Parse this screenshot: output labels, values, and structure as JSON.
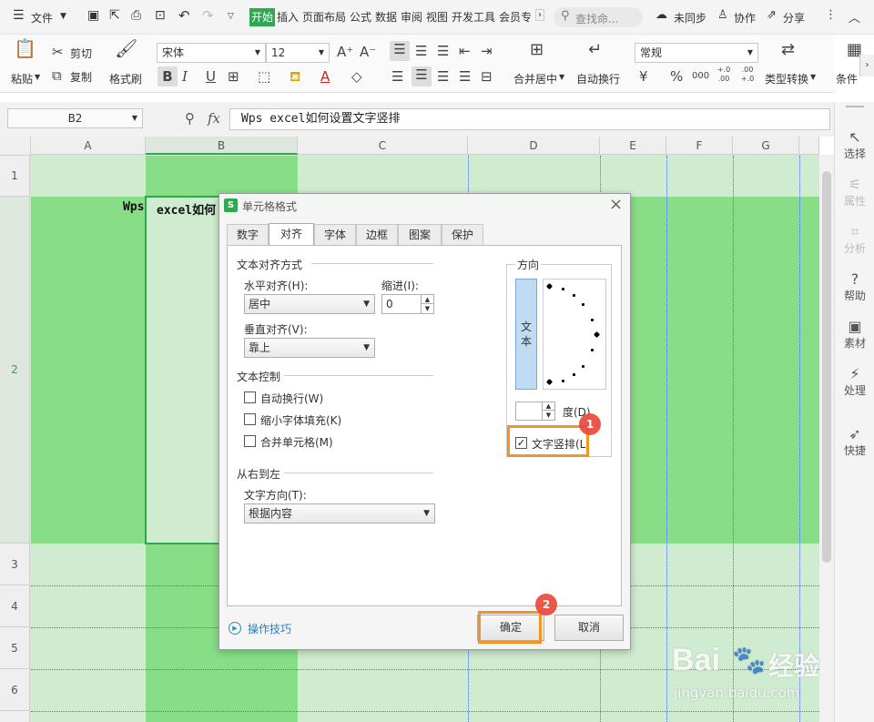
{
  "menubar": {
    "file_label": "文件",
    "tabs": [
      "开始",
      "插入",
      "页面布局",
      "公式",
      "数据",
      "审阅",
      "视图",
      "开发工具",
      "会员专"
    ],
    "search_placeholder": "查找命...",
    "sync_label": "未同步",
    "collab_label": "协作",
    "share_label": "分享"
  },
  "ribbon": {
    "paste": "粘贴",
    "cut": "剪切",
    "copy": "复制",
    "format_painter": "格式刷",
    "font_name": "宋体",
    "font_size": "12",
    "bold": "B",
    "italic": "I",
    "underline": "U",
    "merge_center": "合并居中",
    "auto_wrap": "自动换行",
    "number_format": "常规",
    "type_convert": "类型转换",
    "conditional": "条件",
    "percent": "%",
    "thousands": "000",
    "inc_decimal": "+.0 .00",
    "dec_decimal": ".00 +.0",
    "currency": "¥"
  },
  "formula_bar": {
    "name_box": "B2",
    "fx": "fx",
    "content": "Wps excel如何设置文字竖排"
  },
  "sheet": {
    "columns": [
      "A",
      "B",
      "C",
      "D",
      "E",
      "F",
      "G"
    ],
    "rows": [
      "1",
      "2",
      "3",
      "4",
      "5",
      "6"
    ],
    "cell_a2_visible": "Wps",
    "cell_b2_visible": "excel如何"
  },
  "right_panel": {
    "items": [
      "选择",
      "属性",
      "分析",
      "帮助",
      "素材",
      "处理",
      "快捷"
    ]
  },
  "dialog": {
    "title": "单元格格式",
    "tabs": [
      "数字",
      "对齐",
      "字体",
      "边框",
      "图案",
      "保护"
    ],
    "text_align_group": "文本对齐方式",
    "horizontal_label": "水平对齐(H):",
    "horizontal_value": "居中",
    "indent_label": "缩进(I):",
    "indent_value": "0",
    "vertical_label": "垂直对齐(V):",
    "vertical_value": "靠上",
    "text_control_group": "文本控制",
    "wrap_text": "自动换行(W)",
    "shrink_fit": "缩小字体填充(K)",
    "merge_cells": "合并单元格(M)",
    "rtl_group": "从右到左",
    "text_direction_label": "文字方向(T):",
    "text_direction_value": "根据内容",
    "orientation_group": "方向",
    "orientation_text": "文本",
    "degree_value": "",
    "degree_label": "度(D)",
    "vertical_text": "文字竖排(L)",
    "tips_link": "操作技巧",
    "ok_button": "确定",
    "cancel_button": "取消",
    "close": "×"
  },
  "annotations": {
    "badge1": "1",
    "badge2": "2",
    "highlight_color": "#f39324"
  },
  "watermark": {
    "brand": "Bai",
    "brand_suffix": "经验",
    "url": "jingyan.baidu.com"
  }
}
